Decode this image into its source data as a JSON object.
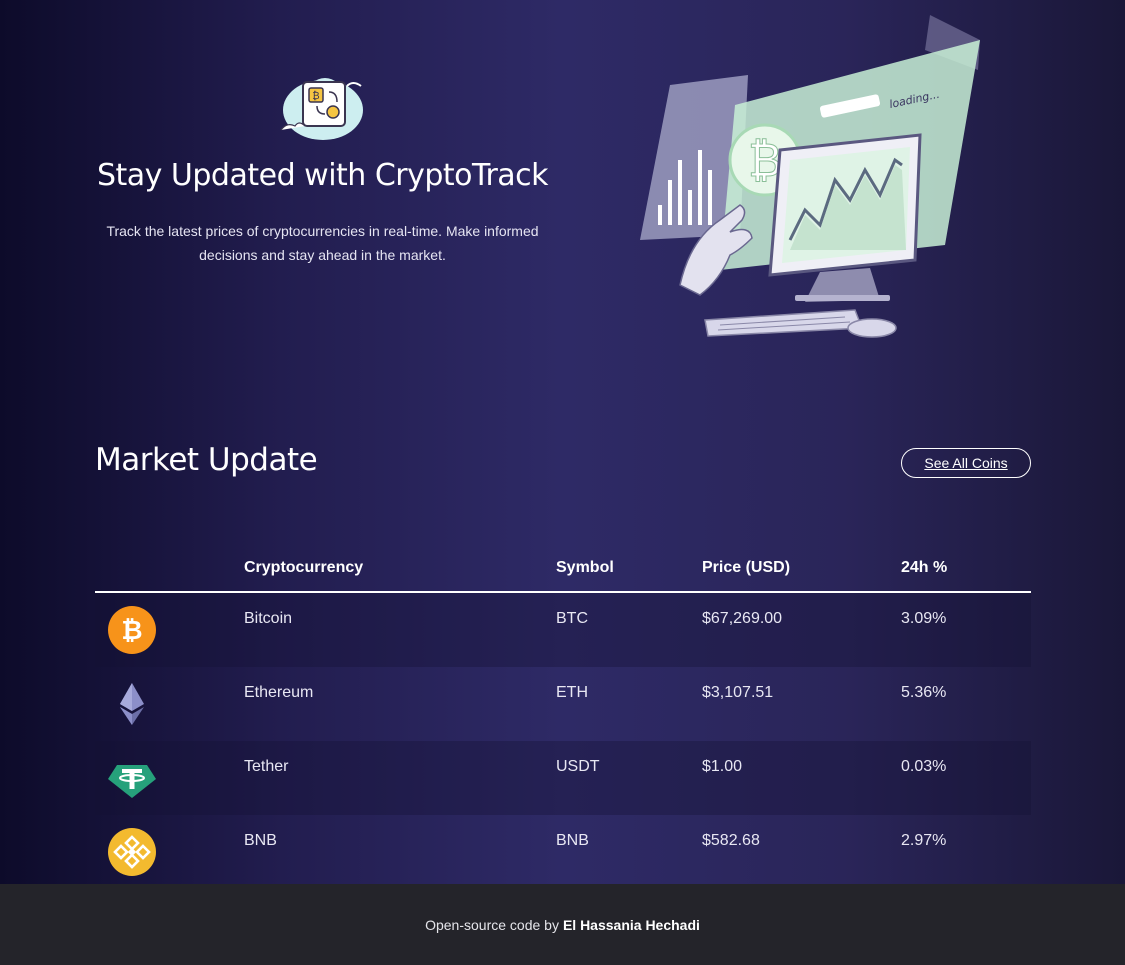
{
  "hero": {
    "title": "Stay Updated with CryptoTrack",
    "text": "Track the latest prices of cryptocurrencies in real-time. Make informed decisions and stay ahead in the market.",
    "illustration_loading_text": "loading..."
  },
  "market": {
    "title": "Market Update",
    "see_all_label": "See All Coins",
    "columns": [
      "Cryptocurrency",
      "Symbol",
      "Price (USD)",
      "24h %"
    ],
    "coins": [
      {
        "name": "Bitcoin",
        "symbol": "BTC",
        "price": "$67,269.00",
        "change": "3.09%",
        "icon": "bitcoin-icon"
      },
      {
        "name": "Ethereum",
        "symbol": "ETH",
        "price": "$3,107.51",
        "change": "5.36%",
        "icon": "ethereum-icon"
      },
      {
        "name": "Tether",
        "symbol": "USDT",
        "price": "$1.00",
        "change": "0.03%",
        "icon": "tether-icon"
      },
      {
        "name": "BNB",
        "symbol": "BNB",
        "price": "$582.68",
        "change": "2.97%",
        "icon": "bnb-icon"
      }
    ]
  },
  "footer": {
    "prefix": "Open-source code by",
    "author": "El Hassania Hechadi"
  },
  "colors": {
    "bitcoin": "#f7931a",
    "ethereum": "#7b7fb8",
    "tether": "#26a17b",
    "bnb": "#f3ba2f",
    "footer_bg": "#24242a"
  }
}
